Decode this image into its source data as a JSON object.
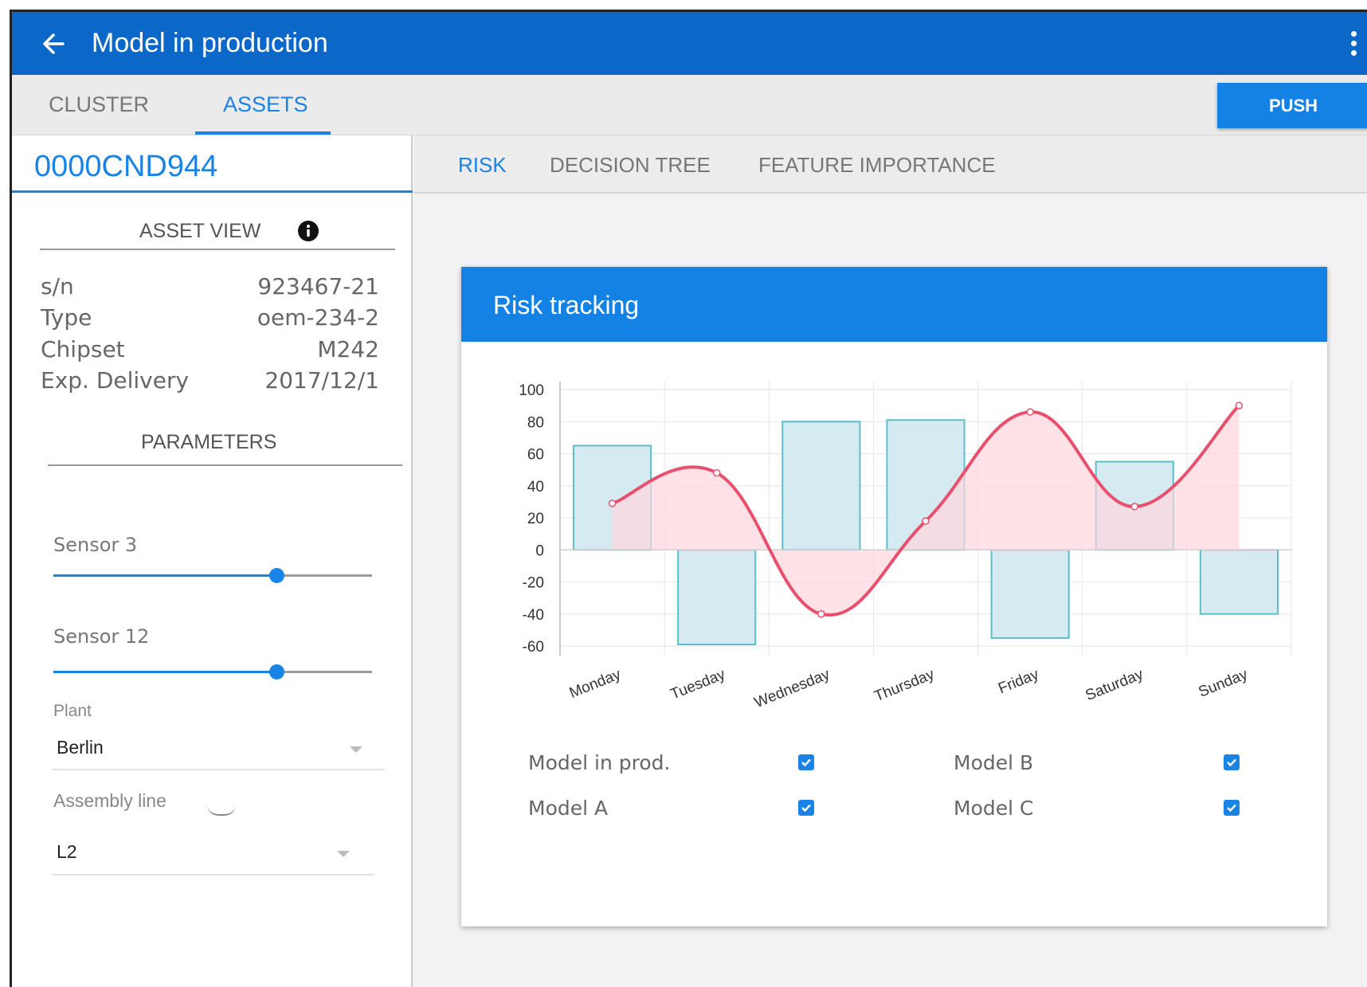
{
  "app": {
    "title": "Model in production"
  },
  "tabs": {
    "cluster": "CLUSTER",
    "assets": "ASSETS"
  },
  "push_label": "PUSH",
  "asset": {
    "id": "0000CND944",
    "view_title": "ASSET VIEW",
    "fields": [
      {
        "key": "s/n",
        "value": "923467-21"
      },
      {
        "key": "Type",
        "value": "oem-234-2"
      },
      {
        "key": "Chipset",
        "value": "M242"
      },
      {
        "key": "Exp. Delivery",
        "value": "2017/12/1"
      }
    ]
  },
  "parameters": {
    "title": "PARAMETERS",
    "sensors": [
      {
        "label": "Sensor 3",
        "value_fraction": 0.7
      },
      {
        "label": "Sensor 12",
        "value_fraction": 0.7
      }
    ],
    "plant": {
      "label": "Plant",
      "value": "Berlin"
    },
    "assembly_line": {
      "label": "Assembly line",
      "value": "L2"
    }
  },
  "content_tabs": {
    "risk": "RISK",
    "decision_tree": "DECISION TREE",
    "feature_importance": "FEATURE IMPORTANCE"
  },
  "card": {
    "title": "Risk tracking"
  },
  "legend": [
    {
      "label": "Model in prod.",
      "checked": true
    },
    {
      "label": "Model B",
      "checked": true
    },
    {
      "label": "Model A",
      "checked": true
    },
    {
      "label": "Model C",
      "checked": true
    }
  ],
  "colors": {
    "primary": "#0b68c9",
    "accent": "#1a83e6",
    "bar_fill": "#d6ebf1",
    "bar_stroke": "#5bbfc8",
    "line": "#e8506e",
    "area": "#ffd6de"
  },
  "chart_data": {
    "type": "bar",
    "categories": [
      "Monday",
      "Tuesday",
      "Wednesday",
      "Thursday",
      "Friday",
      "Saturday",
      "Sunday"
    ],
    "ylim": [
      -60,
      100
    ],
    "yticks": [
      100,
      80,
      60,
      40,
      20,
      0,
      -20,
      -40,
      -60
    ],
    "grid": true,
    "series": [
      {
        "type": "bar",
        "values": [
          65,
          -59,
          80,
          81,
          -55,
          55,
          -40
        ]
      },
      {
        "type": "line",
        "values": [
          29,
          48,
          -40,
          18,
          86,
          27,
          90
        ]
      }
    ]
  }
}
